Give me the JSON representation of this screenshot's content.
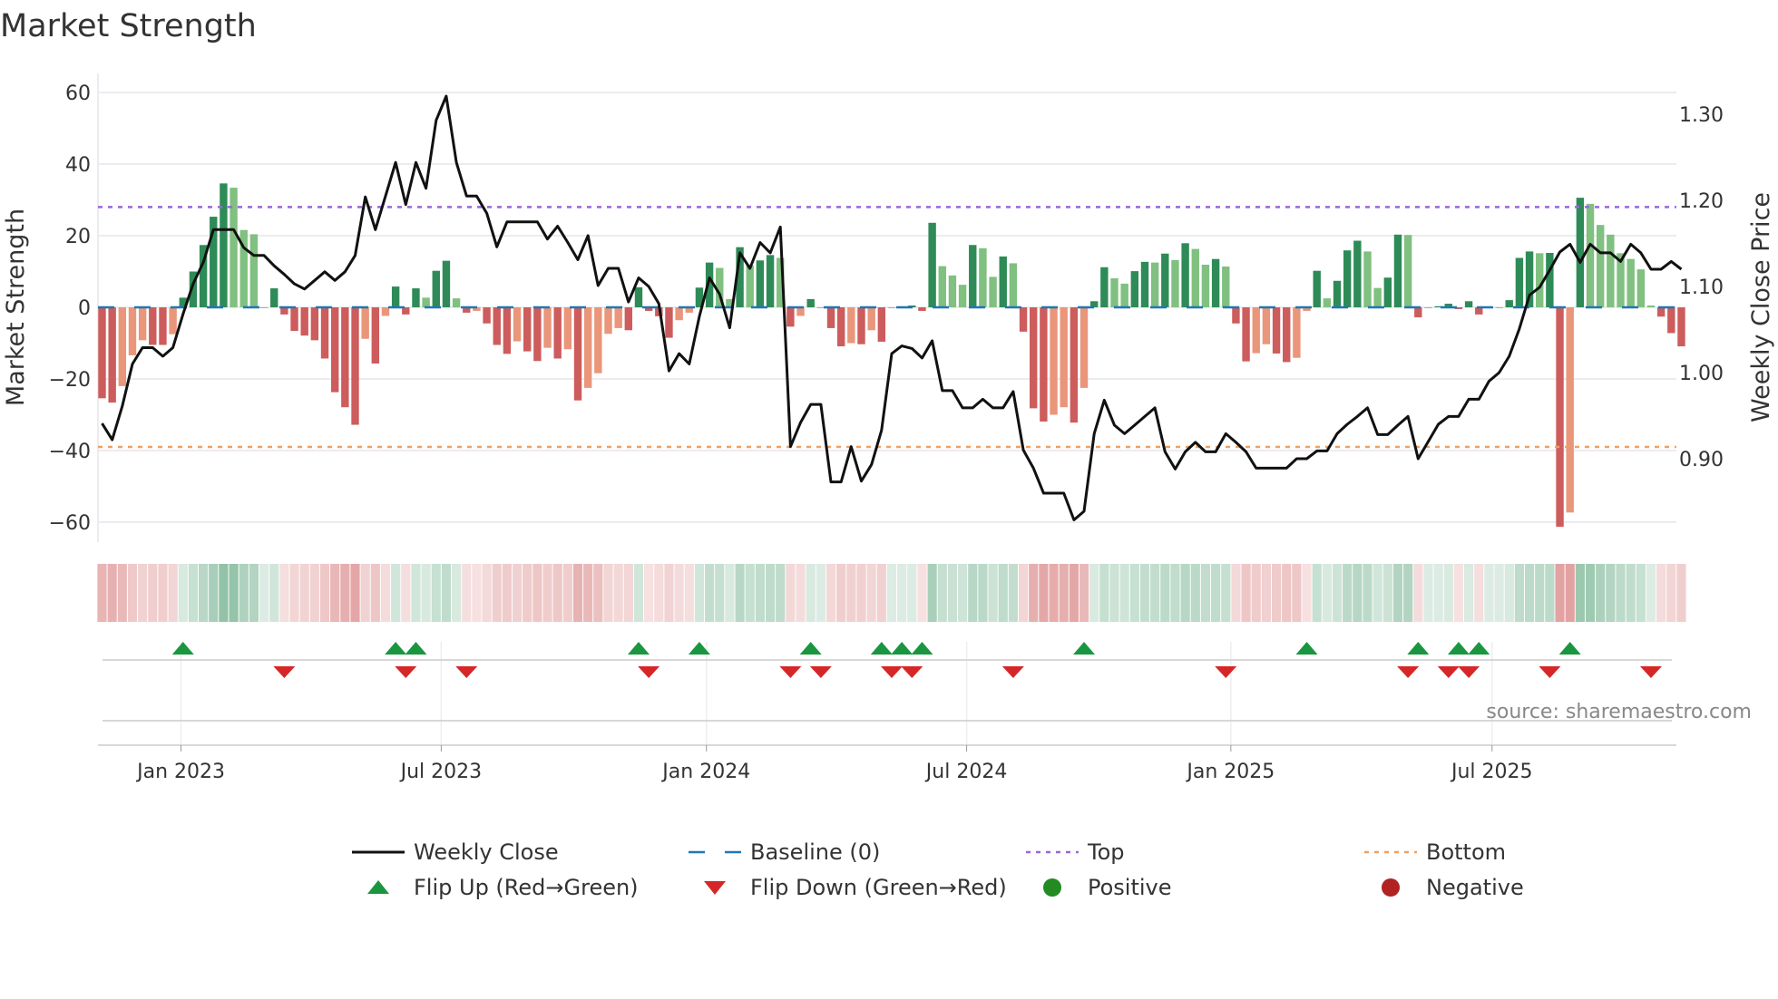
{
  "chart_data": {
    "type": "bar",
    "title": "Market Strength",
    "ylabel": "Market Strength",
    "y2label": "Weekly Close Price",
    "ylim": [
      -66,
      66
    ],
    "y2lim": [
      0.792,
      1.336
    ],
    "yticks": [
      60,
      40,
      20,
      0,
      -20,
      -40,
      -60
    ],
    "ytick_labels": [
      "60",
      "40",
      "20",
      "0",
      "−20",
      "−40",
      "−60"
    ],
    "y2ticks": [
      1.3,
      1.2,
      1.1,
      1.0,
      0.9
    ],
    "y2tick_labels": [
      "1.30",
      "1.20",
      "1.10",
      "1.00",
      "0.90"
    ],
    "xticks": [
      {
        "label": "Jan 2023",
        "index": 7.8
      },
      {
        "label": "Jul 2023",
        "index": 33.5
      },
      {
        "label": "Jan 2024",
        "index": 59.7
      },
      {
        "label": "Jul 2024",
        "index": 85.4
      },
      {
        "label": "Jan 2025",
        "index": 111.5
      },
      {
        "label": "Jul 2025",
        "index": 137.3
      }
    ],
    "top_level": 28,
    "bottom_level": -39,
    "baseline": 0,
    "strength": [
      -25.4,
      -26.6,
      -22,
      -13.4,
      -9.2,
      -10.5,
      -10.5,
      -7.5,
      2.7,
      10,
      17.4,
      25.3,
      34.6,
      33.4,
      21.6,
      20.4,
      0,
      5.3,
      -2,
      -6.6,
      -7.9,
      -9.2,
      -14.3,
      -23.7,
      -27.9,
      -32.8,
      -8.8,
      -15.7,
      -2.4,
      5.8,
      -2,
      5.3,
      2.7,
      10.2,
      13,
      2.5,
      -1.5,
      -1,
      -4.5,
      -10.5,
      -13,
      -9.5,
      -12.3,
      -15,
      -11.3,
      -14.3,
      -11.7,
      -26,
      -22.5,
      -18.4,
      -7.4,
      -5.8,
      -6.4,
      5.6,
      -1,
      -2.5,
      -8.5,
      -3.6,
      -1.5,
      5.5,
      12.5,
      11,
      2.3,
      16.8,
      11.7,
      13.1,
      14.6,
      13.8,
      -5.4,
      -2.4,
      2.3,
      0,
      -5.8,
      -10.9,
      -10,
      -10.3,
      -6.4,
      -9.6,
      0,
      0,
      0.5,
      -1,
      23.6,
      11.5,
      8.9,
      6.3,
      17.4,
      16.5,
      8.5,
      14.2,
      12.3,
      -6.8,
      -28.2,
      -31.9,
      -30,
      -27.9,
      -32.2,
      -22.5,
      1.7,
      11.2,
      8.1,
      6.6,
      10.1,
      12.7,
      12.5,
      15,
      13.2,
      17.9,
      16.3,
      11.9,
      13.5,
      11.4,
      -4.5,
      -15.1,
      -12.8,
      -10.3,
      -12.9,
      -15.3,
      -14.1,
      -1,
      10.2,
      2.5,
      7.4,
      15.9,
      18.6,
      15.6,
      5.4,
      8.3,
      20.3,
      20.2,
      -2.8,
      0,
      0.3,
      1,
      -0.5,
      1.7,
      -2,
      0,
      0,
      2,
      13.8,
      15.6,
      15.1,
      15.2,
      -61.3,
      -57.3,
      30.6,
      28.9,
      23,
      20.3,
      15.1,
      13.5,
      10.6,
      0.5,
      -2.6,
      -7.2,
      -10.9
    ],
    "weekly_close": [
      0.941,
      0.922,
      0.961,
      1.01,
      1.029,
      1.029,
      1.019,
      1.029,
      1.068,
      1.103,
      1.128,
      1.166,
      1.166,
      1.166,
      1.145,
      1.136,
      1.136,
      1.124,
      1.114,
      1.103,
      1.097,
      1.107,
      1.117,
      1.107,
      1.117,
      1.136,
      1.204,
      1.166,
      1.205,
      1.244,
      1.195,
      1.244,
      1.214,
      1.293,
      1.321,
      1.244,
      1.205,
      1.205,
      1.185,
      1.146,
      1.175,
      1.175,
      1.175,
      1.175,
      1.155,
      1.17,
      1.151,
      1.131,
      1.159,
      1.101,
      1.121,
      1.121,
      1.082,
      1.11,
      1.1,
      1.08,
      1.002,
      1.022,
      1.01,
      1.065,
      1.11,
      1.091,
      1.052,
      1.139,
      1.121,
      1.151,
      1.139,
      1.169,
      0.914,
      0.942,
      0.963,
      0.963,
      0.873,
      0.873,
      0.914,
      0.874,
      0.893,
      0.933,
      1.022,
      1.031,
      1.028,
      1.017,
      1.037,
      0.979,
      0.979,
      0.959,
      0.959,
      0.969,
      0.959,
      0.959,
      0.978,
      0.91,
      0.889,
      0.86,
      0.86,
      0.86,
      0.829,
      0.839,
      0.929,
      0.968,
      0.939,
      0.929,
      0.939,
      0.949,
      0.959,
      0.908,
      0.888,
      0.908,
      0.919,
      0.908,
      0.908,
      0.929,
      0.919,
      0.908,
      0.889,
      0.889,
      0.889,
      0.889,
      0.9,
      0.9,
      0.909,
      0.909,
      0.929,
      0.94,
      0.949,
      0.959,
      0.928,
      0.928,
      0.939,
      0.949,
      0.9,
      0.92,
      0.94,
      0.949,
      0.949,
      0.969,
      0.969,
      0.99,
      1.0,
      1.019,
      1.051,
      1.09,
      1.099,
      1.119,
      1.14,
      1.149,
      1.128,
      1.149,
      1.139,
      1.139,
      1.129,
      1.149,
      1.139,
      1.12,
      1.12,
      1.129,
      1.12
    ],
    "flip_up_indices": [
      8,
      29,
      31,
      53,
      59,
      70,
      77,
      79,
      81,
      97,
      119,
      130,
      134,
      136,
      145
    ],
    "flip_down_indices": [
      18,
      30,
      36,
      54,
      68,
      71,
      78,
      80,
      90,
      111,
      129,
      133,
      135,
      143,
      153
    ],
    "legend": {
      "placement": "bottom",
      "items": [
        {
          "label": "Weekly Close",
          "kind": "line"
        },
        {
          "label": "Baseline (0)",
          "kind": "dash"
        },
        {
          "label": "Top",
          "kind": "dot-purple"
        },
        {
          "label": "Bottom",
          "kind": "dot-orange"
        },
        {
          "label": "Flip Up (Red→Green)",
          "kind": "tri-up"
        },
        {
          "label": "Flip Down (Green→Red)",
          "kind": "tri-down"
        },
        {
          "label": "Positive",
          "kind": "circle-green"
        },
        {
          "label": "Negative",
          "kind": "circle-red"
        }
      ]
    },
    "annotation": "source: sharemaestro.com",
    "colors": {
      "pos_strong": "#2e8b57",
      "pos_weak": "#80c080",
      "neg_strong": "#cd5c5c",
      "neg_weak": "#e9967a",
      "line": "#111111",
      "baseline": "#1f77b4",
      "top": "#9966dd",
      "bottom": "#f0a060",
      "flip_up": "#1a9641",
      "flip_down": "#d62728",
      "positive": "#228b22",
      "negative": "#b22222"
    }
  }
}
